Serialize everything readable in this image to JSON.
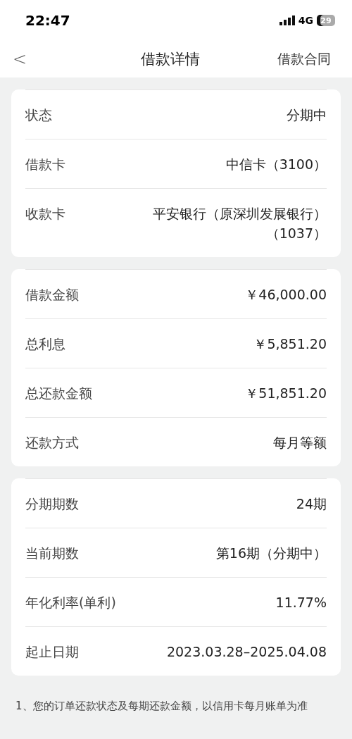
{
  "status_bar": {
    "time": "22:47",
    "network": "4G",
    "battery": "29"
  },
  "nav": {
    "back": "<",
    "title": "借款详情",
    "action": "借款合同"
  },
  "cards": [
    {
      "rows": [
        {
          "label": "状态",
          "value": "分期中"
        },
        {
          "label": "借款卡",
          "value": "中信卡（3100）"
        },
        {
          "label": "收款卡",
          "value": "平安银行（原深圳发展银行）（1037）"
        }
      ]
    },
    {
      "rows": [
        {
          "label": "借款金额",
          "value": "￥46,000.00"
        },
        {
          "label": "总利息",
          "value": "￥5,851.20"
        },
        {
          "label": "总还款金额",
          "value": "￥51,851.20"
        },
        {
          "label": "还款方式",
          "value": "每月等额"
        }
      ]
    },
    {
      "rows": [
        {
          "label": "分期期数",
          "value": "24期"
        },
        {
          "label": "当前期数",
          "value": "第16期（分期中）"
        },
        {
          "label": "年化利率(单利)",
          "value": "11.77%"
        },
        {
          "label": "起止日期",
          "value": "2023.03.28–2025.04.08"
        }
      ]
    }
  ],
  "notes": [
    "1、您的订单还款状态及每期还款金额，以信用卡每月账单为准"
  ]
}
